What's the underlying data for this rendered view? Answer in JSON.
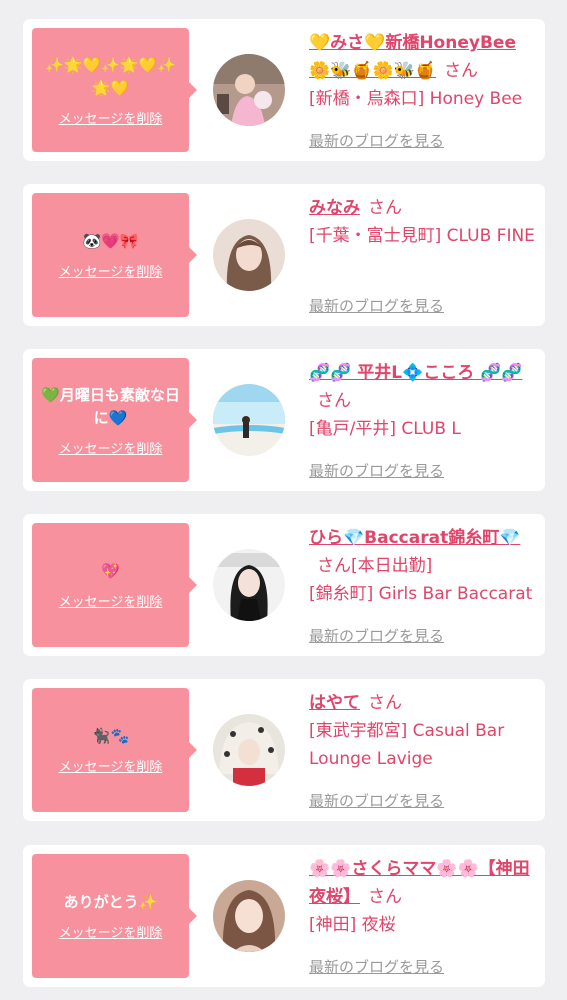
{
  "colors": {
    "background": "#efeff1",
    "card": "#ffffff",
    "bubble": "#f7919e",
    "accent": "#e0456b",
    "muted_link": "#9a9a9a"
  },
  "cards": [
    {
      "message": "✨🌟💛✨🌟💛✨🌟💛",
      "delete_label": "メッセージを削除",
      "name": "💛みさ💛新橋HoneyBee🌼🐝🍯🌼🐝🍯",
      "honorific": "さん",
      "status": "",
      "shop": "[新橋・烏森口] Honey Bee",
      "blog_label": "最新のブログを見る",
      "avatar_icon": "profile-photo-pink-room"
    },
    {
      "message": "🐼💗🎀",
      "delete_label": "メッセージを削除",
      "name": "みなみ",
      "honorific": "さん",
      "status": "",
      "shop": "[千葉・富士見町] CLUB FINE",
      "blog_label": "最新のブログを見る",
      "avatar_icon": "profile-photo-long-hair"
    },
    {
      "message": "💚月曜日も素敵な日に💙",
      "delete_label": "メッセージを削除",
      "name": "🧬🧬 平井L💠こころ 🧬🧬",
      "honorific": "さん",
      "status": "",
      "shop": "[亀戸/平井] CLUB L",
      "blog_label": "最新のブログを見る",
      "avatar_icon": "profile-photo-beach"
    },
    {
      "message": "💖",
      "delete_label": "メッセージを削除",
      "name": "ひら💎Baccarat錦糸町💎",
      "honorific": "さん",
      "status": "[本日出勤]",
      "shop": "[錦糸町] Girls Bar Baccarat",
      "blog_label": "最新のブログを見る",
      "avatar_icon": "profile-photo-black-outfit"
    },
    {
      "message": "🐈‍⬛🐾",
      "delete_label": "メッセージを削除",
      "name": "はやて",
      "honorific": "さん",
      "status": "",
      "shop": "[東武宇都宮] Casual Bar Lounge Lavige",
      "blog_label": "最新のブログを見る",
      "avatar_icon": "profile-photo-leopard-hood"
    },
    {
      "message": "ありがとう✨",
      "delete_label": "メッセージを削除",
      "name": "🌸🌸さくらママ🌸🌸【神田夜桜】",
      "honorific": "さん",
      "status": "",
      "shop": "[神田] 夜桜",
      "blog_label": "最新のブログを見る",
      "avatar_icon": "profile-photo-portrait"
    }
  ]
}
